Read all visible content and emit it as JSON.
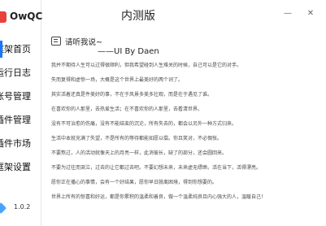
{
  "app": {
    "name": "OwQC",
    "window_title": "内测版",
    "version": "1.0.2"
  },
  "window_controls": {
    "minimize": "—",
    "close": "✕"
  },
  "sidebar": {
    "items": [
      {
        "label": "框架首页"
      },
      {
        "label": "运行日志"
      },
      {
        "label": "账号管理"
      },
      {
        "label": "插件管理"
      },
      {
        "label": "插件市场"
      },
      {
        "label": "框架设置"
      }
    ],
    "active_index": 0
  },
  "main": {
    "greeting": "请听我说~",
    "author": "——UI By Daen",
    "paragraphs": [
      "我并不期待人生可以过得很顺利，但我希望碰到人生难关的时候，自己可以是它的对手。",
      "失而复得和虚惊一场，大概是这个世界上最美好的两个词了。",
      "其实活着还真是件美好的事，不在于风景多美多壮观，而是在于遇见了谁。",
      "在喜欢你的人那里，去热爱生活；在不喜欢你的人那里，去看清世界。",
      "没有不可治愈的伤痛，没有不能结束的沉沦，所有失去的，都会以另外一种方式归来。",
      "生活中本就充满了失望，不是所有的等待都能如愿以偿。你且笑对，不必惆怅。",
      "不要熬过，人的活动就像天上的月亮一样，此消彼长，缺了的部分，还会圆回来。",
      "不要为过往而哭泣，过去的让它都过去吧。不要幻想未来，未来虚无缥缈。活在当下，活得漂亮。",
      "愿你正在播心的事情，会有一个好结果，愿你早日脱离困境，得到你想要的。",
      "世界上所有的惊喜和好运，都是你累积的温柔和善良，做一个温柔纯良且内心强大的人，温暖自己！"
    ]
  },
  "colors": {
    "accent": "#1677ff",
    "logo": "#e8413b",
    "version_icon": "#4aa3ff"
  },
  "icons": {
    "logo": "owqc-logo-icon",
    "greeting": "notebook-icon",
    "version": "diamond-icon"
  }
}
